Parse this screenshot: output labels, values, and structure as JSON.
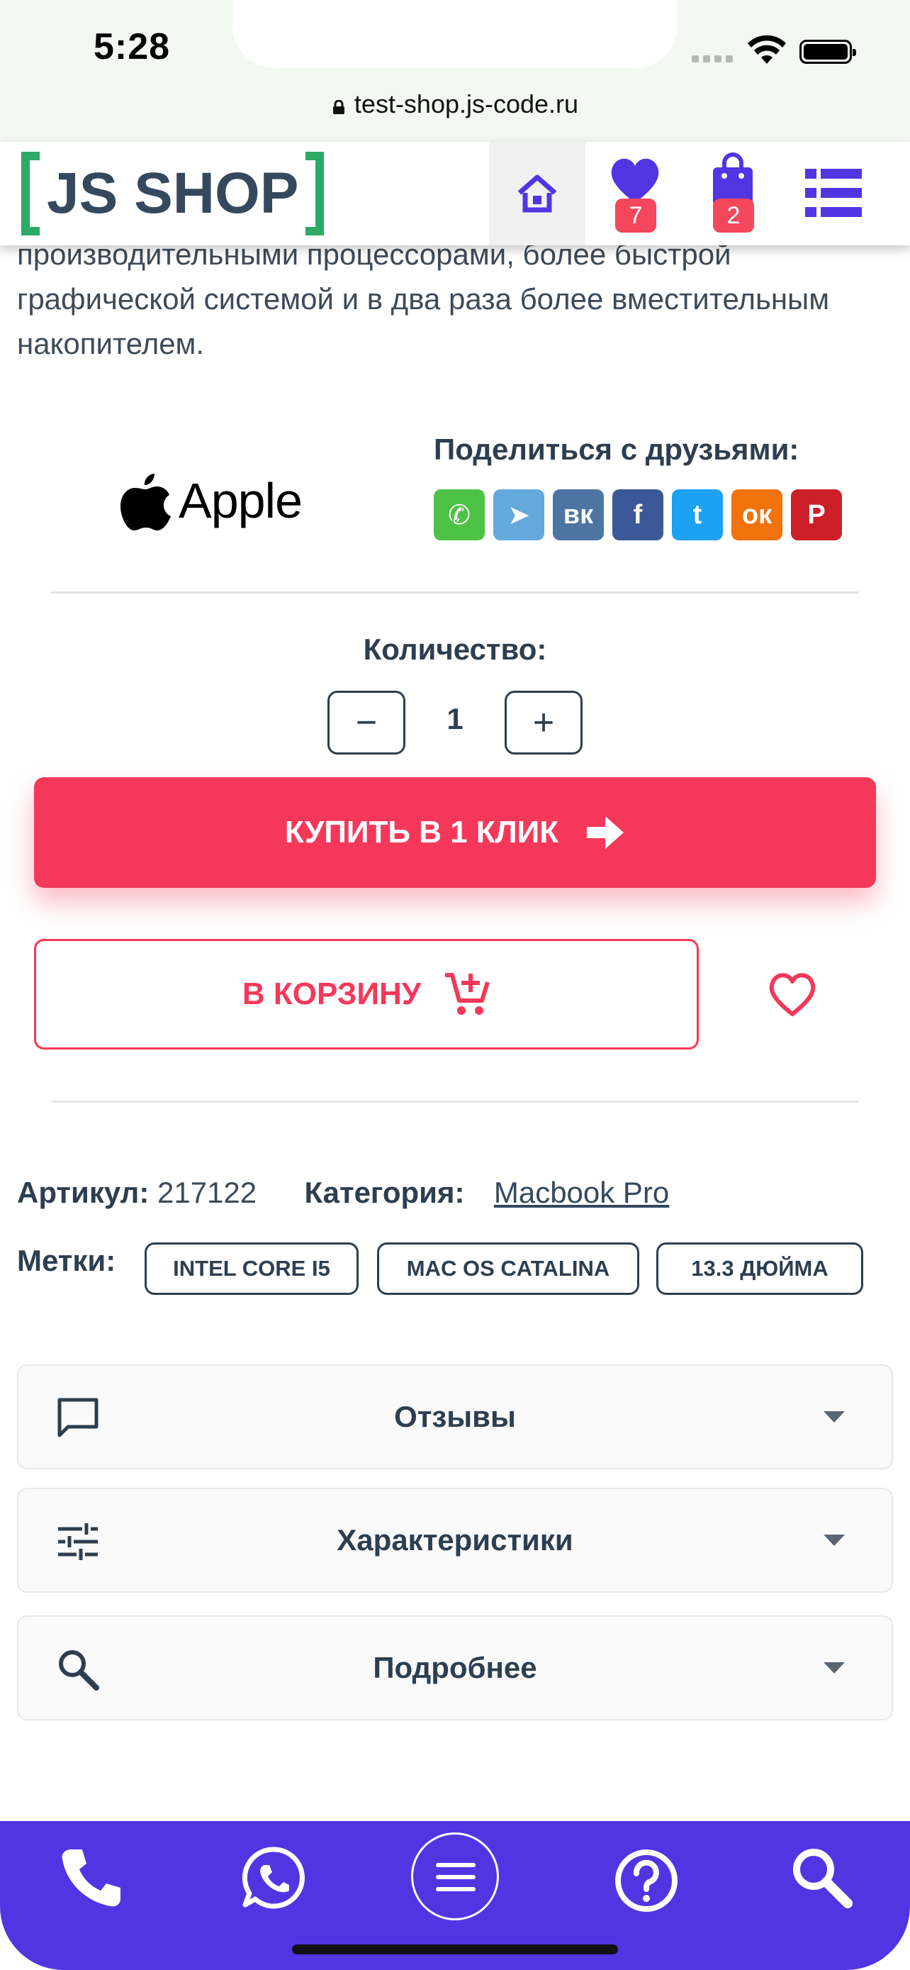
{
  "status_bar": {
    "time": "5:28"
  },
  "browser": {
    "url": "test-shop.js-code.ru"
  },
  "header": {
    "logo_text": "JS SHOP",
    "favorites_count": "7",
    "cart_count": "2"
  },
  "product": {
    "description": "клавиатурой Magic Keyboard, Touch ID, до двух раз более производительными процессорами, более быстрой графической системой и в два раза более вместительным накопителем.",
    "brand": "Apple",
    "share_title": "Поделиться с друзьями:",
    "social": [
      {
        "name": "WhatsApp",
        "glyph": "✆",
        "color": "#4dc247"
      },
      {
        "name": "Telegram",
        "glyph": "➤",
        "color": "#64a9dc"
      },
      {
        "name": "VK",
        "glyph": "вк",
        "color": "#4c75a3"
      },
      {
        "name": "Facebook",
        "glyph": "f",
        "color": "#3b5998"
      },
      {
        "name": "Twitter",
        "glyph": "t",
        "color": "#1da1f2"
      },
      {
        "name": "Odnoklassniki",
        "glyph": "ок",
        "color": "#f2720c"
      },
      {
        "name": "Pinterest",
        "glyph": "P",
        "color": "#cb2027"
      }
    ],
    "quantity_label": "Количество:",
    "quantity": "1",
    "minus": "−",
    "plus": "+",
    "buy_one_click": "КУПИТЬ В 1 КЛИК",
    "add_to_cart": "В КОРЗИНУ",
    "sku_label": "Артикул:",
    "sku": "217122",
    "category_label": "Категория:",
    "category": "Macbook Pro",
    "tags_label": "Метки:",
    "tags": [
      "INTEL CORE I5",
      "MAC OS CATALINA",
      "13.3 ДЮЙМА"
    ]
  },
  "accordions": [
    {
      "label": "Отзывы",
      "icon": "comment-icon"
    },
    {
      "label": "Характеристики",
      "icon": "sliders-icon"
    },
    {
      "label": "Подробнее",
      "icon": "search-icon"
    }
  ],
  "bottom_nav": [
    "phone-icon",
    "whatsapp-icon",
    "menu-icon",
    "help-icon",
    "search-icon"
  ],
  "colors": {
    "accent": "#5135e3",
    "buy": "#f5385a",
    "logo_bracket": "#2daa66",
    "text": "#2d3e50"
  }
}
